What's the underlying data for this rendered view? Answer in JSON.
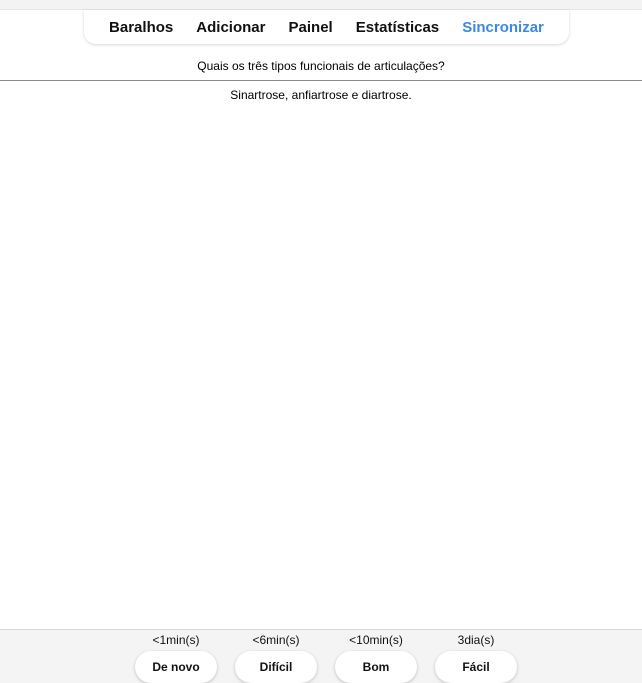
{
  "nav": {
    "items": [
      {
        "label": "Baralhos",
        "active": false
      },
      {
        "label": "Adicionar",
        "active": false
      },
      {
        "label": "Painel",
        "active": false
      },
      {
        "label": "Estatísticas",
        "active": false
      },
      {
        "label": "Sincronizar",
        "active": true
      }
    ],
    "active_color": "#3d87e3"
  },
  "card": {
    "question": "Quais os três tipos funcionais de articulações?",
    "answer": "Sinartrose, anfiartrose e diartrose."
  },
  "answer_buttons": [
    {
      "interval": "<1min(s)",
      "label": "De novo"
    },
    {
      "interval": "<6min(s)",
      "label": "Difícil"
    },
    {
      "interval": "<10min(s)",
      "label": "Bom"
    },
    {
      "interval": "3dia(s)",
      "label": "Fácil"
    }
  ]
}
